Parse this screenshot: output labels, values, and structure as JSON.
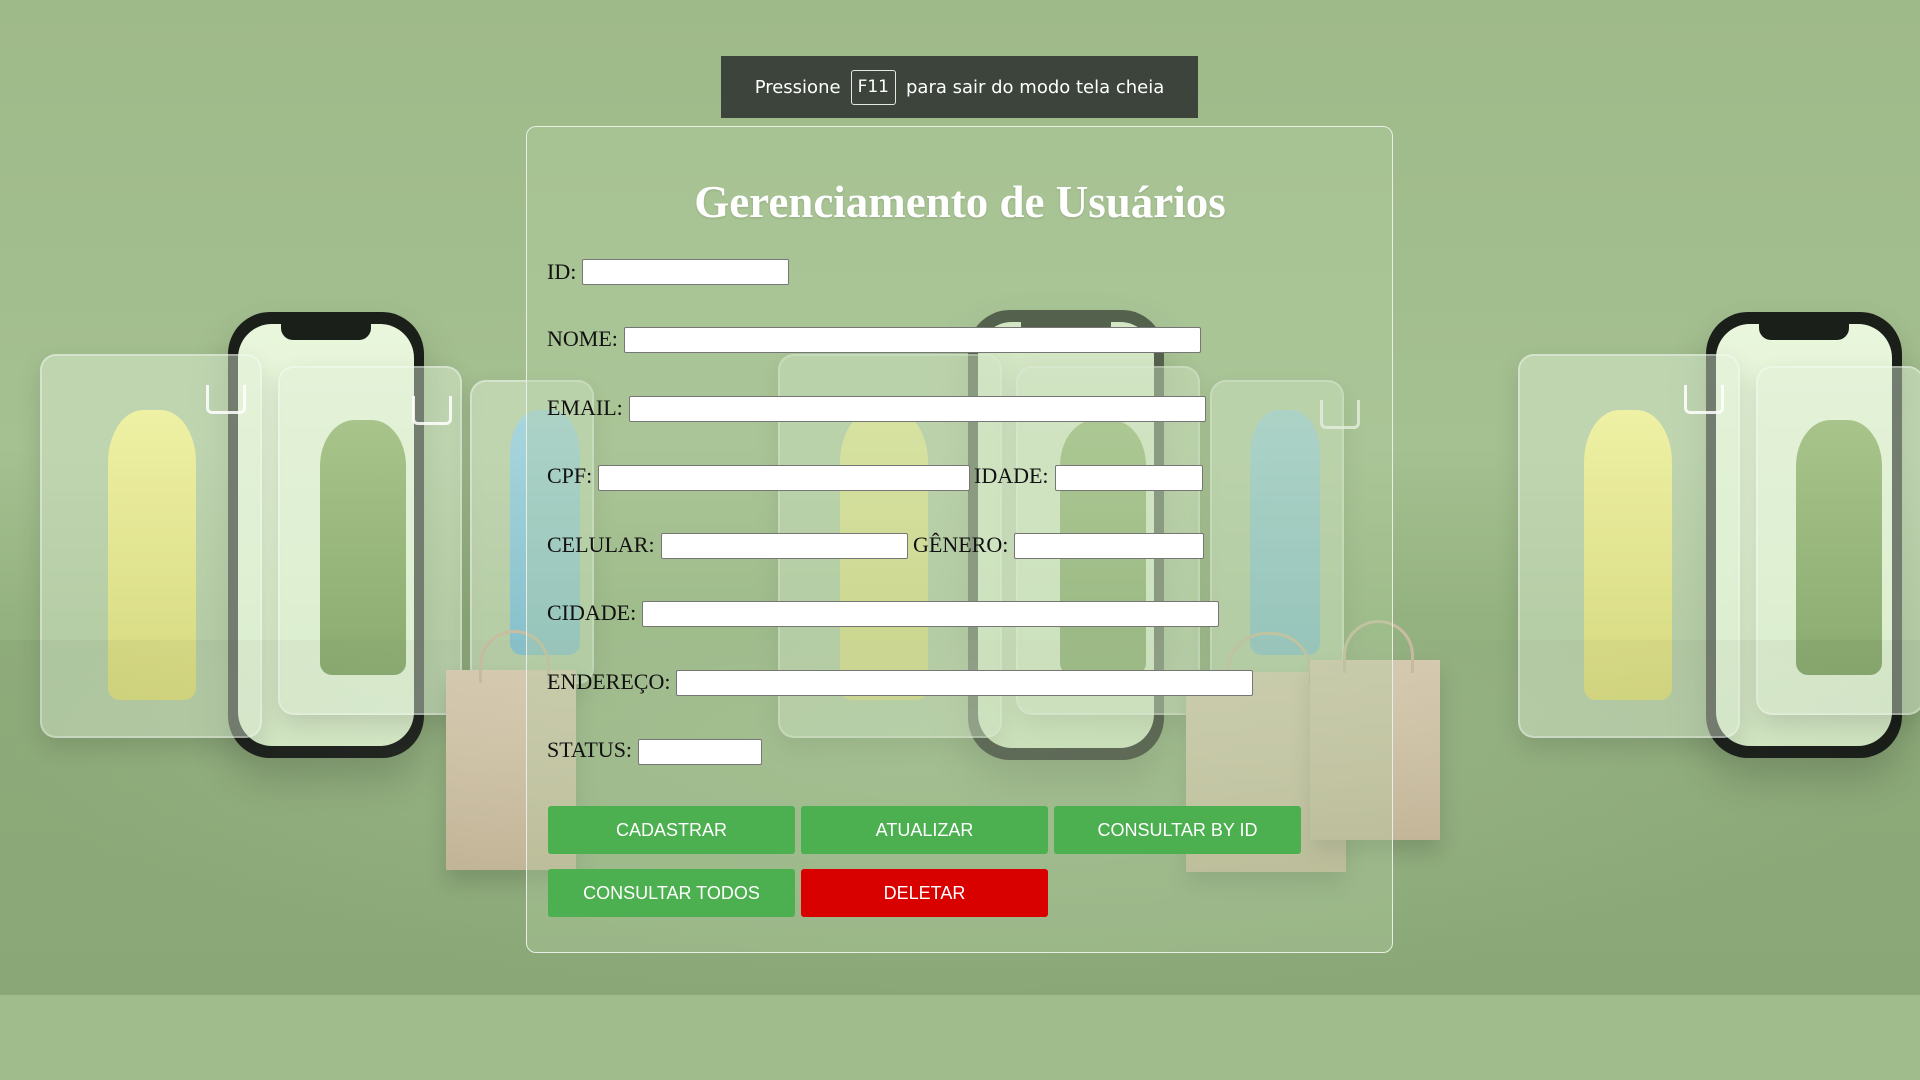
{
  "fullscreen_notice": {
    "before": "Pressione",
    "key": "F11",
    "after": "para sair do modo tela cheia"
  },
  "form": {
    "title": "Gerenciamento de Usuários",
    "fields": {
      "id": {
        "label": "ID:",
        "value": ""
      },
      "nome": {
        "label": "NOME:",
        "value": ""
      },
      "email": {
        "label": "EMAIL:",
        "value": ""
      },
      "cpf": {
        "label": "CPF:",
        "value": ""
      },
      "idade": {
        "label": "IDADE:",
        "value": ""
      },
      "celular": {
        "label": "CELULAR:",
        "value": ""
      },
      "genero": {
        "label": "GÊNERO:",
        "value": ""
      },
      "cidade": {
        "label": "CIDADE:",
        "value": ""
      },
      "endereco": {
        "label": "ENDEREÇO:",
        "value": ""
      },
      "status": {
        "label": "STATUS:",
        "value": ""
      }
    },
    "buttons": {
      "cadastrar": "CADASTRAR",
      "atualizar": "ATUALIZAR",
      "consultar_by_id": "CONSULTAR BY ID",
      "consultar_todos": "CONSULTAR TODOS",
      "deletar": "DELETAR"
    }
  },
  "colors": {
    "background": "#a0bb8c",
    "button_primary": "#4caf50",
    "button_danger": "#d90000",
    "notice_background": "#3c443c"
  }
}
